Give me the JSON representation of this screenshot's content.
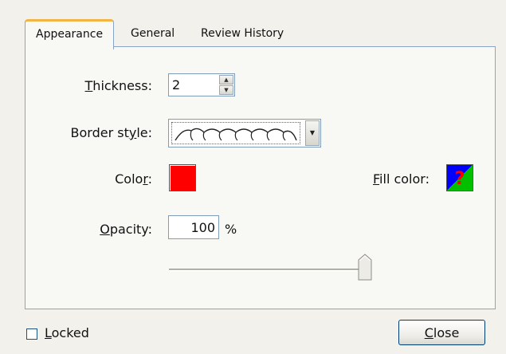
{
  "tabs": [
    {
      "label": "Appearance",
      "active": true
    },
    {
      "label": "General",
      "active": false
    },
    {
      "label": "Review History",
      "active": false
    }
  ],
  "thickness": {
    "label_access": "T",
    "label_rest": "hickness:",
    "value": "2"
  },
  "border_style": {
    "label_pre": "Border st",
    "label_access": "y",
    "label_rest": "le:",
    "selected_icon": "cloudy-border-icon"
  },
  "color": {
    "label_pre": "Colo",
    "label_access": "r",
    "label_rest": ":",
    "value": "#ff0000"
  },
  "fill_color": {
    "label_access": "F",
    "label_rest": "ill color:",
    "icon": "question-mark-icon",
    "colors": [
      "#0000ff",
      "#00c000",
      "#ff0000"
    ]
  },
  "opacity": {
    "label_access": "O",
    "label_rest": "pacity:",
    "value": "100",
    "unit": "%",
    "slider_fraction": 1.0
  },
  "locked": {
    "label_access": "L",
    "label_rest": "ocked",
    "checked": false
  },
  "close_button": {
    "label_access": "C",
    "label_rest": "lose"
  }
}
